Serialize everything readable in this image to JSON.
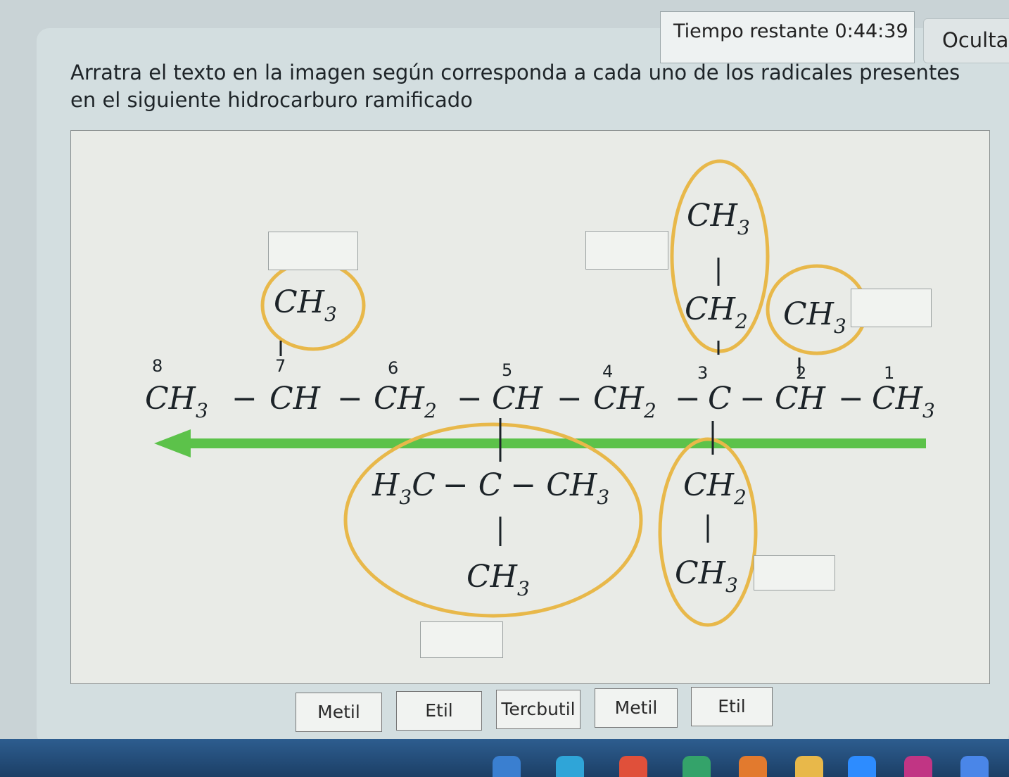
{
  "header": {
    "timer_label": "Tiempo restante",
    "timer_value": "0:44:39",
    "hide_label": "Ocultar"
  },
  "instructions": "Arratra el texto en la imagen según corresponda a cada uno de los radicales presentes en el siguiente hidrocarburo ramificado",
  "molecule": {
    "chain": {
      "c8": "CH",
      "c8_sub": "3",
      "c7": "CH",
      "c6": "CH",
      "c6_sub": "2",
      "c5": "CH",
      "c4": "CH",
      "c4_sub": "2",
      "c3": "C",
      "c2": "CH",
      "c1": "CH",
      "c1_sub": "3",
      "bond": "−"
    },
    "numbers": [
      "8",
      "7",
      "6",
      "5",
      "4",
      "3",
      "2",
      "1"
    ],
    "branches": {
      "methyl_c7": "CH",
      "methyl_c7_sub": "3",
      "ethyl_top_ch3": "CH",
      "ethyl_top_ch3_sub": "3",
      "ethyl_top_ch2": "CH",
      "ethyl_top_ch2_sub": "2",
      "methyl_c2": "CH",
      "methyl_c2_sub": "3",
      "tbutyl_left": "H",
      "tbutyl_left_sub": "3",
      "tbutyl_left_c": "C",
      "tbutyl_center": "C",
      "tbutyl_right": "CH",
      "tbutyl_right_sub": "3",
      "tbutyl_bottom": "CH",
      "tbutyl_bottom_sub": "3",
      "ethyl_bottom_ch2": "CH",
      "ethyl_bottom_ch2_sub": "2",
      "ethyl_bottom_ch3": "CH",
      "ethyl_bottom_ch3_sub": "3"
    },
    "colors": {
      "arrow": "#5cc24a",
      "circle": "#e8b84a",
      "text": "#1c2328"
    }
  },
  "labels": [
    "Metil",
    "Etil",
    "Tercbutil",
    "Metil",
    "Etil"
  ]
}
